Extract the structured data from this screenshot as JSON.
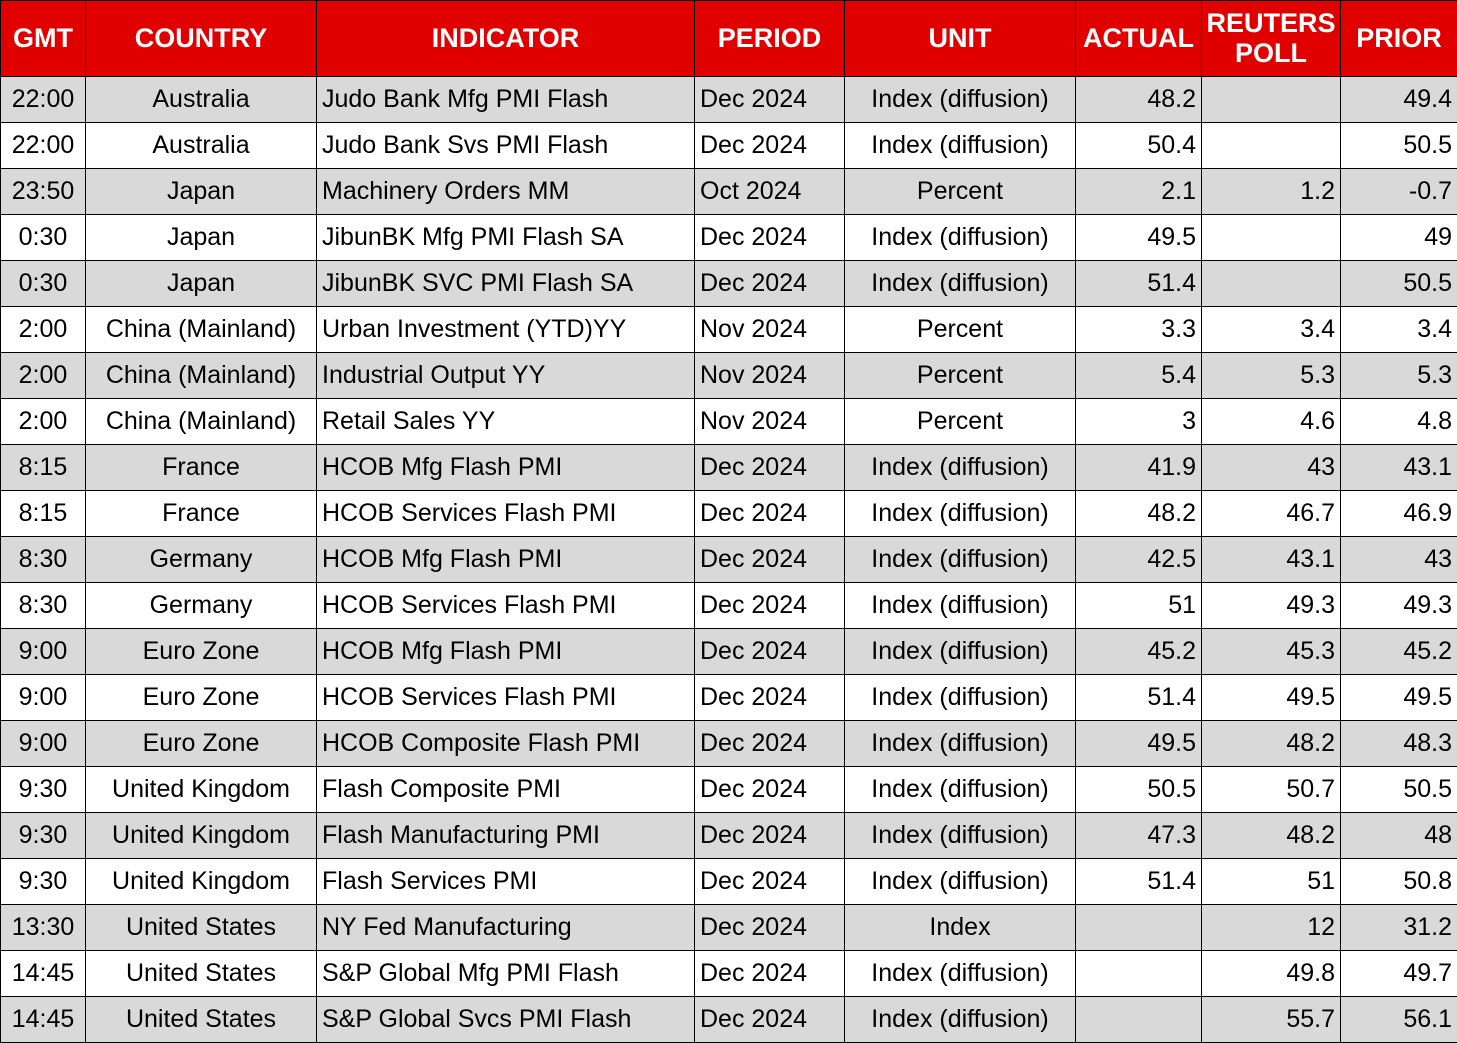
{
  "table": {
    "headers": {
      "gmt": "GMT",
      "country": "COUNTRY",
      "indicator": "INDICATOR",
      "period": "PERIOD",
      "unit": "UNIT",
      "actual": "ACTUAL",
      "reuters_poll": "REUTERS POLL",
      "prior": "PRIOR"
    },
    "colors": {
      "header_bg": "#e00000",
      "header_text": "#ffffff",
      "stripe_bg": "#d9d9d9"
    },
    "rows": [
      {
        "gmt": "22:00",
        "country": "Australia",
        "indicator": "Judo Bank Mfg PMI Flash",
        "period": "Dec 2024",
        "unit": "Index (diffusion)",
        "actual": "48.2",
        "reuters_poll": "",
        "prior": "49.4"
      },
      {
        "gmt": "22:00",
        "country": "Australia",
        "indicator": "Judo Bank Svs PMI Flash",
        "period": "Dec 2024",
        "unit": "Index (diffusion)",
        "actual": "50.4",
        "reuters_poll": "",
        "prior": "50.5"
      },
      {
        "gmt": "23:50",
        "country": "Japan",
        "indicator": "Machinery Orders MM",
        "period": "Oct 2024",
        "unit": "Percent",
        "actual": "2.1",
        "reuters_poll": "1.2",
        "prior": "-0.7"
      },
      {
        "gmt": "0:30",
        "country": "Japan",
        "indicator": "JibunBK Mfg PMI Flash SA",
        "period": "Dec 2024",
        "unit": "Index (diffusion)",
        "actual": "49.5",
        "reuters_poll": "",
        "prior": "49"
      },
      {
        "gmt": "0:30",
        "country": "Japan",
        "indicator": "JibunBK SVC PMI Flash SA",
        "period": "Dec 2024",
        "unit": "Index (diffusion)",
        "actual": "51.4",
        "reuters_poll": "",
        "prior": "50.5"
      },
      {
        "gmt": "2:00",
        "country": "China (Mainland)",
        "indicator": "Urban Investment (YTD)YY",
        "period": "Nov 2024",
        "unit": "Percent",
        "actual": "3.3",
        "reuters_poll": "3.4",
        "prior": "3.4"
      },
      {
        "gmt": "2:00",
        "country": "China (Mainland)",
        "indicator": "Industrial Output YY",
        "period": "Nov 2024",
        "unit": "Percent",
        "actual": "5.4",
        "reuters_poll": "5.3",
        "prior": "5.3"
      },
      {
        "gmt": "2:00",
        "country": "China (Mainland)",
        "indicator": "Retail Sales YY",
        "period": "Nov 2024",
        "unit": "Percent",
        "actual": "3",
        "reuters_poll": "4.6",
        "prior": "4.8"
      },
      {
        "gmt": "8:15",
        "country": "France",
        "indicator": "HCOB Mfg Flash PMI",
        "period": "Dec 2024",
        "unit": "Index (diffusion)",
        "actual": "41.9",
        "reuters_poll": "43",
        "prior": "43.1"
      },
      {
        "gmt": "8:15",
        "country": "France",
        "indicator": "HCOB Services Flash PMI",
        "period": "Dec 2024",
        "unit": "Index (diffusion)",
        "actual": "48.2",
        "reuters_poll": "46.7",
        "prior": "46.9"
      },
      {
        "gmt": "8:30",
        "country": "Germany",
        "indicator": "HCOB Mfg Flash PMI",
        "period": "Dec 2024",
        "unit": "Index (diffusion)",
        "actual": "42.5",
        "reuters_poll": "43.1",
        "prior": "43"
      },
      {
        "gmt": "8:30",
        "country": "Germany",
        "indicator": "HCOB Services Flash PMI",
        "period": "Dec 2024",
        "unit": "Index (diffusion)",
        "actual": "51",
        "reuters_poll": "49.3",
        "prior": "49.3"
      },
      {
        "gmt": "9:00",
        "country": "Euro Zone",
        "indicator": "HCOB Mfg Flash PMI",
        "period": "Dec 2024",
        "unit": "Index (diffusion)",
        "actual": "45.2",
        "reuters_poll": "45.3",
        "prior": "45.2"
      },
      {
        "gmt": "9:00",
        "country": "Euro Zone",
        "indicator": "HCOB Services Flash PMI",
        "period": "Dec 2024",
        "unit": "Index (diffusion)",
        "actual": "51.4",
        "reuters_poll": "49.5",
        "prior": "49.5"
      },
      {
        "gmt": "9:00",
        "country": "Euro Zone",
        "indicator": "HCOB Composite Flash PMI",
        "period": "Dec 2024",
        "unit": "Index (diffusion)",
        "actual": "49.5",
        "reuters_poll": "48.2",
        "prior": "48.3"
      },
      {
        "gmt": "9:30",
        "country": "United Kingdom",
        "indicator": "Flash Composite PMI",
        "period": "Dec 2024",
        "unit": "Index (diffusion)",
        "actual": "50.5",
        "reuters_poll": "50.7",
        "prior": "50.5"
      },
      {
        "gmt": "9:30",
        "country": "United Kingdom",
        "indicator": "Flash Manufacturing PMI",
        "period": "Dec 2024",
        "unit": "Index (diffusion)",
        "actual": "47.3",
        "reuters_poll": "48.2",
        "prior": "48"
      },
      {
        "gmt": "9:30",
        "country": "United Kingdom",
        "indicator": "Flash Services PMI",
        "period": "Dec 2024",
        "unit": "Index (diffusion)",
        "actual": "51.4",
        "reuters_poll": "51",
        "prior": "50.8"
      },
      {
        "gmt": "13:30",
        "country": "United States",
        "indicator": "NY Fed Manufacturing",
        "period": "Dec 2024",
        "unit": "Index",
        "actual": "",
        "reuters_poll": "12",
        "prior": "31.2"
      },
      {
        "gmt": "14:45",
        "country": "United States",
        "indicator": "S&P Global Mfg PMI Flash",
        "period": "Dec 2024",
        "unit": "Index (diffusion)",
        "actual": "",
        "reuters_poll": "49.8",
        "prior": "49.7"
      },
      {
        "gmt": "14:45",
        "country": "United States",
        "indicator": "S&P Global Svcs PMI Flash",
        "period": "Dec 2024",
        "unit": "Index (diffusion)",
        "actual": "",
        "reuters_poll": "55.7",
        "prior": "56.1"
      }
    ]
  }
}
